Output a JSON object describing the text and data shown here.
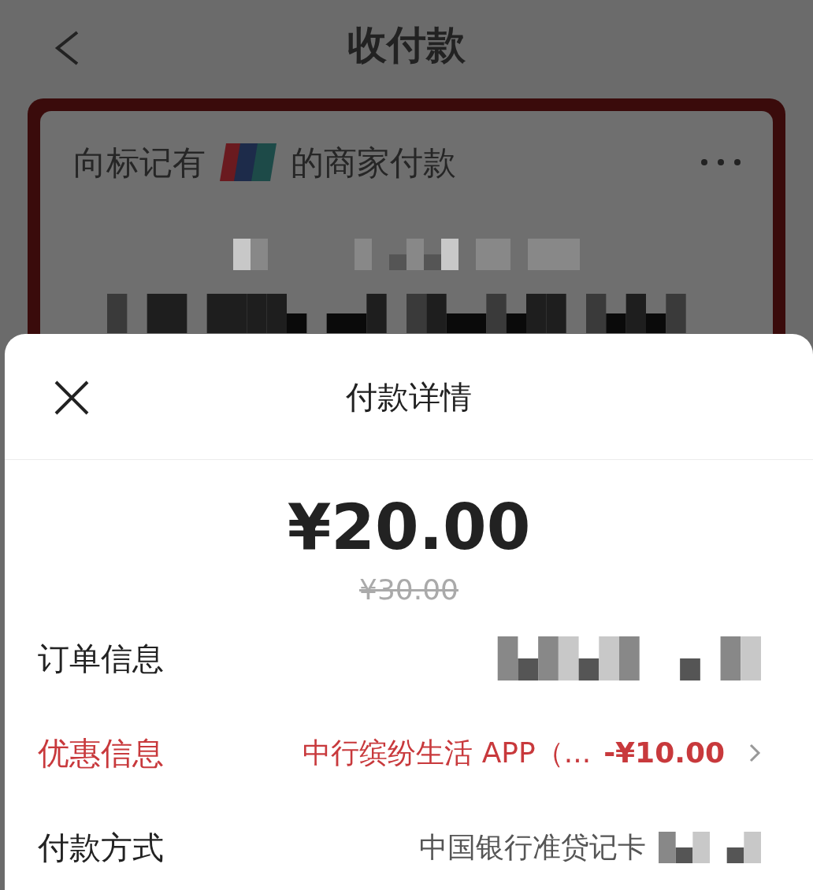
{
  "header": {
    "title": "收付款"
  },
  "card": {
    "prompt_before": "向标记有",
    "prompt_after": "的商家付款",
    "redacted": true
  },
  "sheet": {
    "title": "付款详情",
    "amount": "¥20.00",
    "original_amount": "¥30.00",
    "rows": [
      {
        "kind": "plain",
        "label": "订单信息",
        "redacted": true
      },
      {
        "kind": "discount",
        "label": "优惠信息",
        "value": "中行缤纷生活 APP（...",
        "amount": "-¥10.00"
      },
      {
        "kind": "plain",
        "label": "付款方式",
        "value": "中国银行准贷记卡",
        "redacted": true
      }
    ]
  }
}
